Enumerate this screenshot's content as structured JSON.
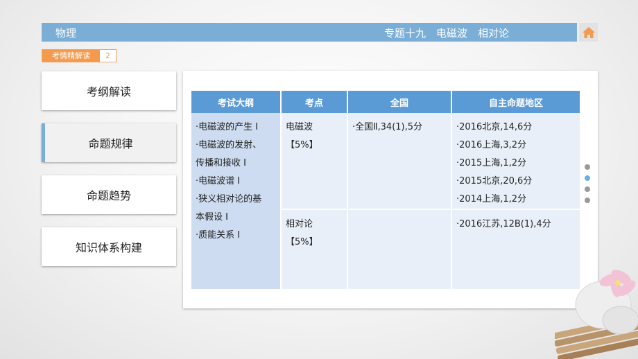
{
  "header": {
    "subject": "物理",
    "chapter": "专题十九　电磁波　相对论"
  },
  "section_tag": {
    "label": "考情精解读",
    "number": "2"
  },
  "nav": [
    {
      "label": "考纲解读"
    },
    {
      "label": "命题规律"
    },
    {
      "label": "命题趋势"
    },
    {
      "label": "知识体系构建"
    }
  ],
  "table": {
    "headers": [
      "考试大纲",
      "考点",
      "全国",
      "自主命题地区"
    ],
    "outline": [
      "·电磁波的产生 Ⅰ",
      "·电磁波的发射、",
      "传播和接收 Ⅰ",
      "·电磁波谱 Ⅰ",
      "·狭义相对论的基",
      "本假设 Ⅰ",
      "·质能关系 Ⅰ"
    ],
    "rows": [
      {
        "point": [
          "电磁波",
          "【5%】"
        ],
        "national": [
          "·全国Ⅱ,34(1),5分"
        ],
        "regional": [
          "·2016北京,14,6分",
          "·2016上海,3,2分",
          "·2015上海,1,2分",
          "·2015北京,20,6分",
          "·2014上海,1,2分"
        ]
      },
      {
        "point": [
          "相对论",
          "【5%】"
        ],
        "national": [],
        "regional": [
          "·2016江苏,12B(1),4分"
        ]
      }
    ]
  },
  "colors": {
    "header_bar": "#7aaed6",
    "table_header": "#5b9bd5",
    "accent_orange": "#f39a4d",
    "home_icon": "#f39a4d"
  },
  "icons": {
    "home": "home-icon"
  }
}
